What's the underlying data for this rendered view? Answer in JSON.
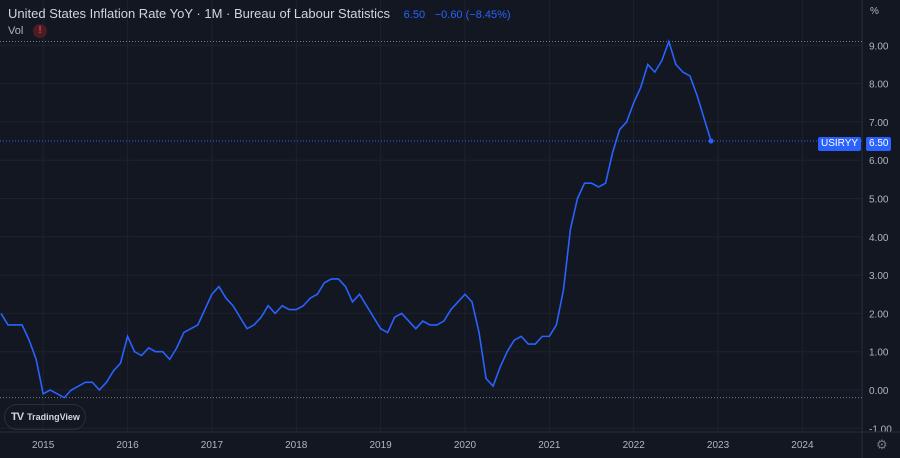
{
  "legend": {
    "title": "United States Inflation Rate YoY · 1M · Bureau of Labour Statistics",
    "value": "6.50",
    "change": "−0.60 (−8.45%)",
    "vol_label": "Vol",
    "warning_icon": "!"
  },
  "axis_unit": "%",
  "symbol_tag": "USIRYY",
  "price_tag": "6.50",
  "logo_text": "TradingView",
  "colors": {
    "background": "#131722",
    "line": "#2962ff",
    "grid": "#1e222d",
    "text": "#b2b5be"
  },
  "chart_data": {
    "type": "line",
    "title": "United States Inflation Rate YoY",
    "xlabel": "",
    "ylabel": "%",
    "start": "2014-07",
    "frequency": "monthly",
    "x_ticks": [
      "2015",
      "2016",
      "2017",
      "2018",
      "2019",
      "2020",
      "2021",
      "2022",
      "2023",
      "2024"
    ],
    "y_ticks": [
      "-1.00",
      "0.00",
      "1.00",
      "2.00",
      "3.00",
      "4.00",
      "5.00",
      "6.00",
      "7.00",
      "8.00",
      "9.00"
    ],
    "ylim": [
      -1.2,
      9.7
    ],
    "series": [
      {
        "name": "USIRYY",
        "values": [
          2.0,
          1.7,
          1.7,
          1.7,
          1.3,
          0.8,
          -0.1,
          0.0,
          -0.1,
          -0.2,
          0.0,
          0.1,
          0.2,
          0.2,
          0.0,
          0.2,
          0.5,
          0.7,
          1.4,
          1.0,
          0.9,
          1.1,
          1.0,
          1.0,
          0.8,
          1.1,
          1.5,
          1.6,
          1.7,
          2.1,
          2.5,
          2.7,
          2.4,
          2.2,
          1.9,
          1.6,
          1.7,
          1.9,
          2.2,
          2.0,
          2.2,
          2.1,
          2.1,
          2.2,
          2.4,
          2.5,
          2.8,
          2.9,
          2.9,
          2.7,
          2.3,
          2.5,
          2.2,
          1.9,
          1.6,
          1.5,
          1.9,
          2.0,
          1.8,
          1.6,
          1.8,
          1.7,
          1.7,
          1.8,
          2.1,
          2.3,
          2.5,
          2.3,
          1.5,
          0.3,
          0.1,
          0.6,
          1.0,
          1.3,
          1.4,
          1.2,
          1.2,
          1.4,
          1.4,
          1.7,
          2.6,
          4.2,
          5.0,
          5.4,
          5.4,
          5.3,
          5.4,
          6.2,
          6.8,
          7.0,
          7.5,
          7.9,
          8.5,
          8.3,
          8.6,
          9.1,
          8.5,
          8.3,
          8.2,
          7.7,
          7.1,
          6.5
        ]
      }
    ],
    "high": 9.1,
    "low": -0.2,
    "last": 6.5,
    "grid": true
  }
}
